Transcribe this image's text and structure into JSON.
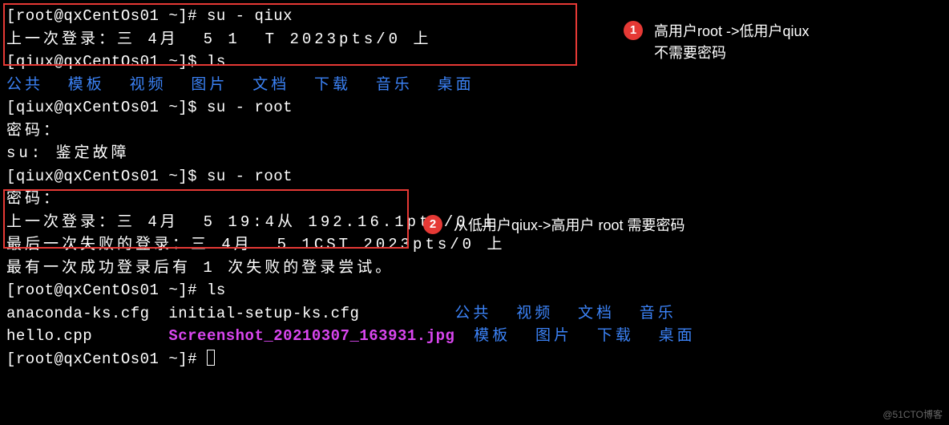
{
  "lines": {
    "l1_prompt": "[root@qxCentOs01 ~]# ",
    "l1_cmd": "su - qiux",
    "l2": "上一次登录：三 4月  5 1",
    "l2b": "  ",
    "l2c": "T 2023pts/0 上",
    "l3_prompt": "[qiux@qxCentOs01 ~]$ ",
    "l3_cmd": "ls",
    "l4": "公共  模板  视频  图片  文档  下载  音乐  桌面",
    "l5_prompt": "[qiux@qxCentOs01 ~]$ ",
    "l5_cmd": "su - root",
    "l6": "密码：",
    "l7": "su: 鉴定故障",
    "l8_prompt": "[qiux@qxCentOs01 ~]$ ",
    "l8_cmd": "su - root",
    "l9": "密码：",
    "l10a": "上一次登录：三 4月  5 19:4",
    "l10b": "从 192.16",
    "l10c": ".1pts/0 上",
    "l11a": "最后一次失败的登录：三 4月  5 1",
    "l11b": "CST 2023pts/0 上",
    "l12": "最有一次成功登录后有 1 次失败的登录尝试。",
    "l13_prompt": "[root@qxCentOs01 ~]# ",
    "l13_cmd": "ls",
    "l14a": "anaconda-ks.cfg  initial-setup-ks.cfg          ",
    "l14b": "公共  视频  文档  音乐",
    "l15a": "hello.cpp        ",
    "l15b": "Screenshot_20210307_163931.jpg",
    "l15c": "  ",
    "l15d": "模板  图片  下载  桌面",
    "l16_prompt": "[root@qxCentOs01 ~]# "
  },
  "annotations": {
    "a1_num": "1",
    "a1_text_l1": "高用户root ->低用户qiux",
    "a1_text_l2": "不需要密码",
    "a2_num": "2",
    "a2_text": "从低用户qiux->高用户 root 需要密码"
  },
  "watermark": "@51CTO博客"
}
